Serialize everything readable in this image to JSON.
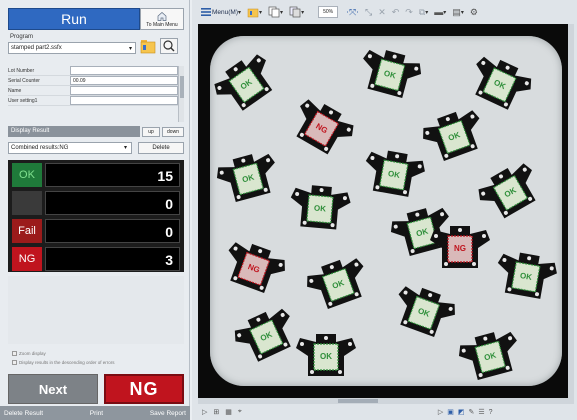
{
  "run_bar": {
    "run_label": "Run",
    "main_menu_label": "To Main Menu"
  },
  "program": {
    "label": "Program",
    "value": "stamped part2.ssfx"
  },
  "info": [
    {
      "key": "Lot Number",
      "value": ""
    },
    {
      "key": "Serial Counter",
      "value": "00.09"
    },
    {
      "key": "Name",
      "value": ""
    },
    {
      "key": "User setting1",
      "value": ""
    }
  ],
  "display_result": {
    "title": "Display Result",
    "up": "up",
    "down": "down",
    "combined": "Combined results:NG",
    "delete": "Delete"
  },
  "results": [
    {
      "label": "OK",
      "value": "15",
      "color": "#1f7a3a",
      "text_color": "#7fe08f"
    },
    {
      "label": "",
      "value": "0",
      "color": "#3a3a3a",
      "text_color": "#ffffff"
    },
    {
      "label": "Fail",
      "value": "0",
      "color": "#9b1b1b",
      "text_color": "#ffffff"
    },
    {
      "label": "NG",
      "value": "3",
      "color": "#c0141e",
      "text_color": "#ffffff"
    }
  ],
  "options": {
    "zoom_display": "Zoom display",
    "descending": "Display results in the descending order of errors"
  },
  "bottom": {
    "next": "Next",
    "ng": "NG"
  },
  "footer": {
    "delete_result": "Delete Result",
    "print": "Print",
    "save_report": "Save Report"
  },
  "toolbar": {
    "menu": "Menu(M)",
    "zoom": "50%"
  },
  "parts_labels": {
    "ok": "OK",
    "ng": "NG"
  },
  "colors": {
    "accent": "#2f69c1",
    "ng": "#c0141e",
    "ok_green": "#1f7a3a"
  }
}
